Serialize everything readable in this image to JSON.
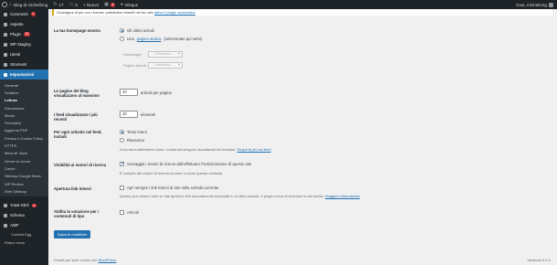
{
  "adminbar": {
    "site_name": "Blog di michelinng",
    "updates_count": "17",
    "comments_count": "0",
    "new_label": "+ Nuovo",
    "notifications_count": "4",
    "plugin_label": "Disqus",
    "greeting": "Ciao, michelinng"
  },
  "sidebar": {
    "top_items": [
      {
        "label": "Commenti",
        "badge": "1"
      },
      {
        "label": "Aspetto",
        "badge": ""
      },
      {
        "label": "Plugin",
        "badge": "10"
      },
      {
        "label": "WP Staging",
        "badge": ""
      },
      {
        "label": "Utenti",
        "badge": ""
      },
      {
        "label": "Strumenti",
        "badge": ""
      },
      {
        "label": "Impostazioni",
        "badge": ""
      }
    ],
    "sub_items": [
      "Generali",
      "Scrittura",
      "Lettura",
      "Discussione",
      "Media",
      "Permalink",
      "Aggiorna PHP",
      "Privacy e Cookie Policy",
      "HTTPS",
      "Meta all' inizio",
      "Server to server",
      "Cache",
      "Sitemap Google News",
      "WP Review",
      "Web Sitemap"
    ],
    "bottom_items": [
      {
        "label": "Yoast SEO",
        "badge": "4"
      },
      {
        "label": "Schema",
        "badge": ""
      },
      {
        "label": "AMP",
        "badge": ""
      }
    ],
    "extra_items": [
      "Content Egg",
      "Riduci menu"
    ]
  },
  "notice": {
    "text": "Guadagna di più con i banner pubblicitari inseriti nel tuo sito",
    "link": "attiva il plugin automatico"
  },
  "settings": {
    "homepage": {
      "label": "La tua homepage mostra",
      "option1": "Gli ultimi articoli",
      "option2_prefix": "Una",
      "option2_link": "pagina statica",
      "option2_suffix": "(selezionate qui sotto)",
      "homepage_label": "Homepage:",
      "homepage_value": "— Seleziona —",
      "posts_page_label": "Pagina articoli:",
      "posts_page_value": "— Seleziona —"
    },
    "blog_pages": {
      "label": "Le pagine del blog visualizzano al massimo",
      "value": "10",
      "unit": "articoli per pagina"
    },
    "feeds": {
      "label": "I feed visualizzano i più recenti",
      "value": "10",
      "unit": "elementi"
    },
    "feed_content": {
      "label": "Per ogni articolo nei feed, includi",
      "option1": "Testo intero",
      "option2": "Riassunto",
      "desc_text": "Il tuo tema determina come i contenuti vengono visualizzati nei browser.",
      "desc_link": "Scopri di più sui feed"
    },
    "search_visibility": {
      "label": "Visibilità ai motori di ricerca",
      "checkbox": "Scoraggia i motori di ricerca dall'effettuare l'indicizzazione di questo sito",
      "desc": "È compito dei motori di ricerca onorare o meno questa richiesta."
    },
    "open_links": {
      "label": "Apertura link interni",
      "checkbox": "Apri sempre i link interni al sito nella scheda corrente",
      "desc_text": "Questo può essere utile se stai aprendo link manualmente impostati in un'altra scheda, il plugin cerca di ricordare la tua scelta.",
      "desc_link": "Maggiori informazioni"
    },
    "ratings": {
      "label": "Abilita la votazione per i contenuti di tipo",
      "checkbox": "Articoli"
    }
  },
  "save_button": "Salva le modifiche",
  "footer": {
    "text": "Grazie per aver creato con",
    "link": "WordPress",
    "version": "Versione 6.0.2"
  }
}
